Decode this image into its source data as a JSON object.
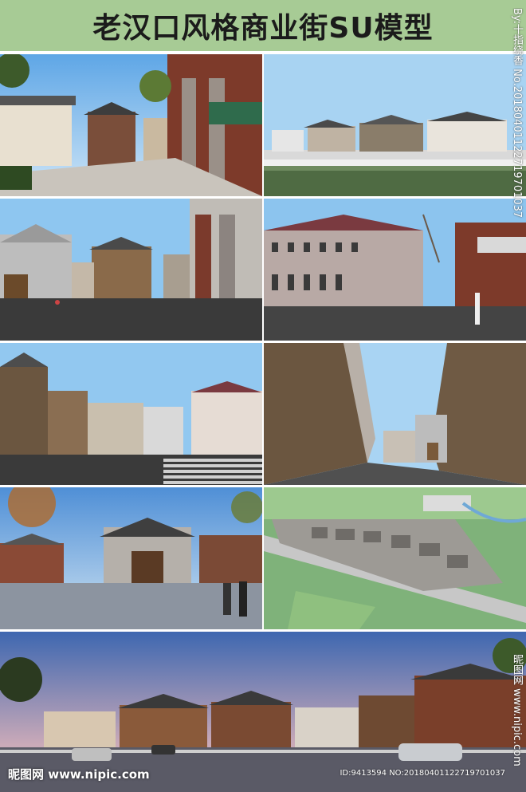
{
  "title": "老汉口风格商业街SU模型",
  "watermark": {
    "vertical_top": "By:十指绕香 No.20180401122719701037",
    "vertical_bottom": "昵图网 www.nipic.com",
    "footer_logo": "昵图网 www.nipic.com",
    "footer_id": "ID:9413594 NO:20180401122719701037"
  },
  "colors": {
    "title_band": "#a7cb95",
    "sky": "#8fc2ea",
    "brick": "#8a4a36",
    "gray_wall": "#8c8c8c",
    "pavement": "#3a3a3a"
  },
  "tiles": [
    {
      "name": "street-perspective-render",
      "kind": "photo-render"
    },
    {
      "name": "waterfront-elevation-model",
      "kind": "sketchup-view"
    },
    {
      "name": "plaza-gray-buildings-model",
      "kind": "sketchup-view"
    },
    {
      "name": "european-style-building-model",
      "kind": "sketchup-view"
    },
    {
      "name": "plaza-staircase-model",
      "kind": "sketchup-view"
    },
    {
      "name": "narrow-alley-model",
      "kind": "sketchup-view"
    },
    {
      "name": "archway-plaza-render",
      "kind": "photo-render"
    },
    {
      "name": "aerial-site-model",
      "kind": "sketchup-view"
    },
    {
      "name": "street-panorama-render",
      "kind": "photo-render"
    }
  ]
}
